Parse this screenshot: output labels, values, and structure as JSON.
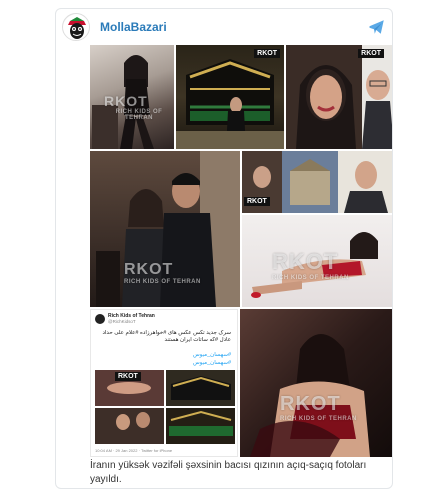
{
  "channel": {
    "name": "MollaBazari",
    "avatar_icon": "mollabazari-logo-icon",
    "share_icon": "telegram-icon",
    "accent": "#2b7bb9"
  },
  "watermarks": {
    "brand": "RKOT",
    "tagline": "RICH KIDS OF TEHRAN"
  },
  "tweet": {
    "name": "Rich Kids of Tehran",
    "handle": "@RichKidsoT",
    "text": "سرک جدید تکس عکس های #خواهرزاده #علام علی حداد عادل #که ساتات ایران هستند",
    "tags": [
      "#سهسان_میوس",
      "#سهسان_میوس"
    ],
    "meta": "10:04 AM · 29 Jan 2022 · Twitter for iPhone"
  },
  "caption": "İranın yüksək vəzifəli şəxsinin bacısı qızının açıq-saçıq fotoları yayıldı."
}
